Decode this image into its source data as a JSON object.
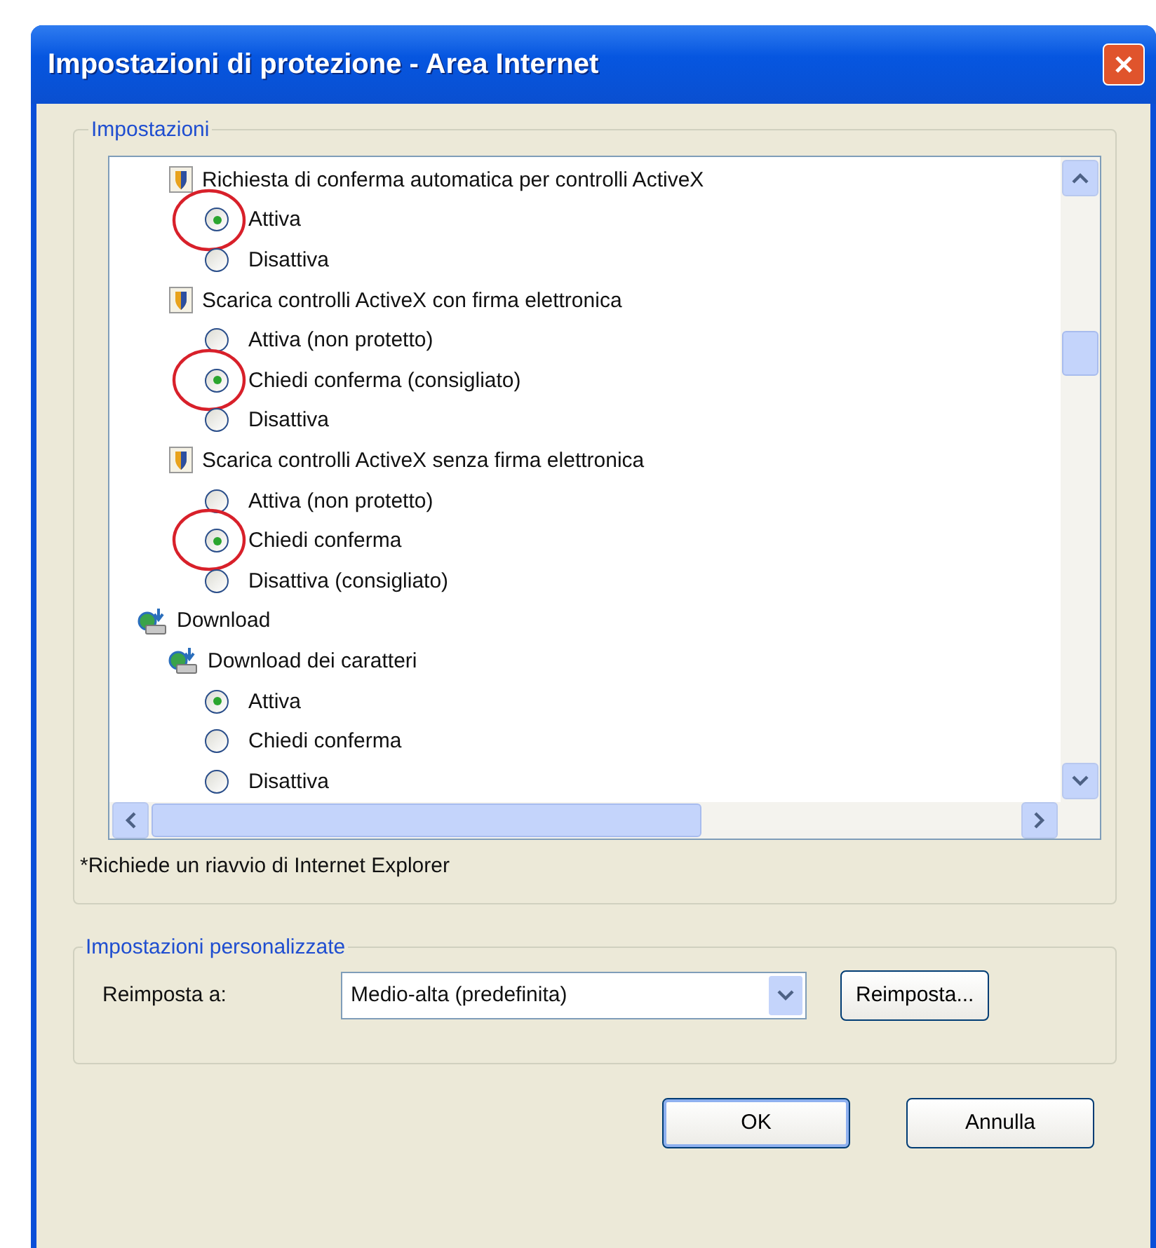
{
  "window": {
    "title": "Impostazioni di protezione - Area Internet"
  },
  "settings_group": {
    "title": "Impostazioni",
    "tree": [
      {
        "kind": "setting",
        "label": "Richiesta di conferma automatica per controlli ActiveX",
        "children": [
          {
            "kind": "option",
            "label": "Attiva",
            "selected": true,
            "circled": true
          },
          {
            "kind": "option",
            "label": "Disattiva",
            "selected": false,
            "circled": false
          }
        ]
      },
      {
        "kind": "setting",
        "label": "Scarica controlli ActiveX con firma elettronica",
        "children": [
          {
            "kind": "option",
            "label": "Attiva (non protetto)",
            "selected": false,
            "circled": false
          },
          {
            "kind": "option",
            "label": "Chiedi conferma (consigliato)",
            "selected": true,
            "circled": true
          },
          {
            "kind": "option",
            "label": "Disattiva",
            "selected": false,
            "circled": false
          }
        ]
      },
      {
        "kind": "setting",
        "label": "Scarica controlli ActiveX senza firma elettronica",
        "children": [
          {
            "kind": "option",
            "label": "Attiva (non protetto)",
            "selected": false,
            "circled": false
          },
          {
            "kind": "option",
            "label": "Chiedi conferma",
            "selected": true,
            "circled": true
          },
          {
            "kind": "option",
            "label": "Disattiva (consigliato)",
            "selected": false,
            "circled": false
          }
        ]
      },
      {
        "kind": "category",
        "label": "Download",
        "children": [
          {
            "kind": "download-setting",
            "label": "Download dei caratteri",
            "children": [
              {
                "kind": "option",
                "label": "Attiva",
                "selected": true,
                "circled": false
              },
              {
                "kind": "option",
                "label": "Chiedi conferma",
                "selected": false,
                "circled": false
              },
              {
                "kind": "option",
                "label": "Disattiva",
                "selected": false,
                "circled": false
              }
            ]
          }
        ]
      }
    ],
    "footnote": "*Richiede un riavvio di Internet Explorer"
  },
  "custom_group": {
    "title": "Impostazioni personalizzate",
    "reset_label": "Reimposta a:",
    "reset_value": "Medio-alta (predefinita)",
    "reset_button": "Reimposta..."
  },
  "buttons": [
    "OK",
    "Annulla"
  ]
}
